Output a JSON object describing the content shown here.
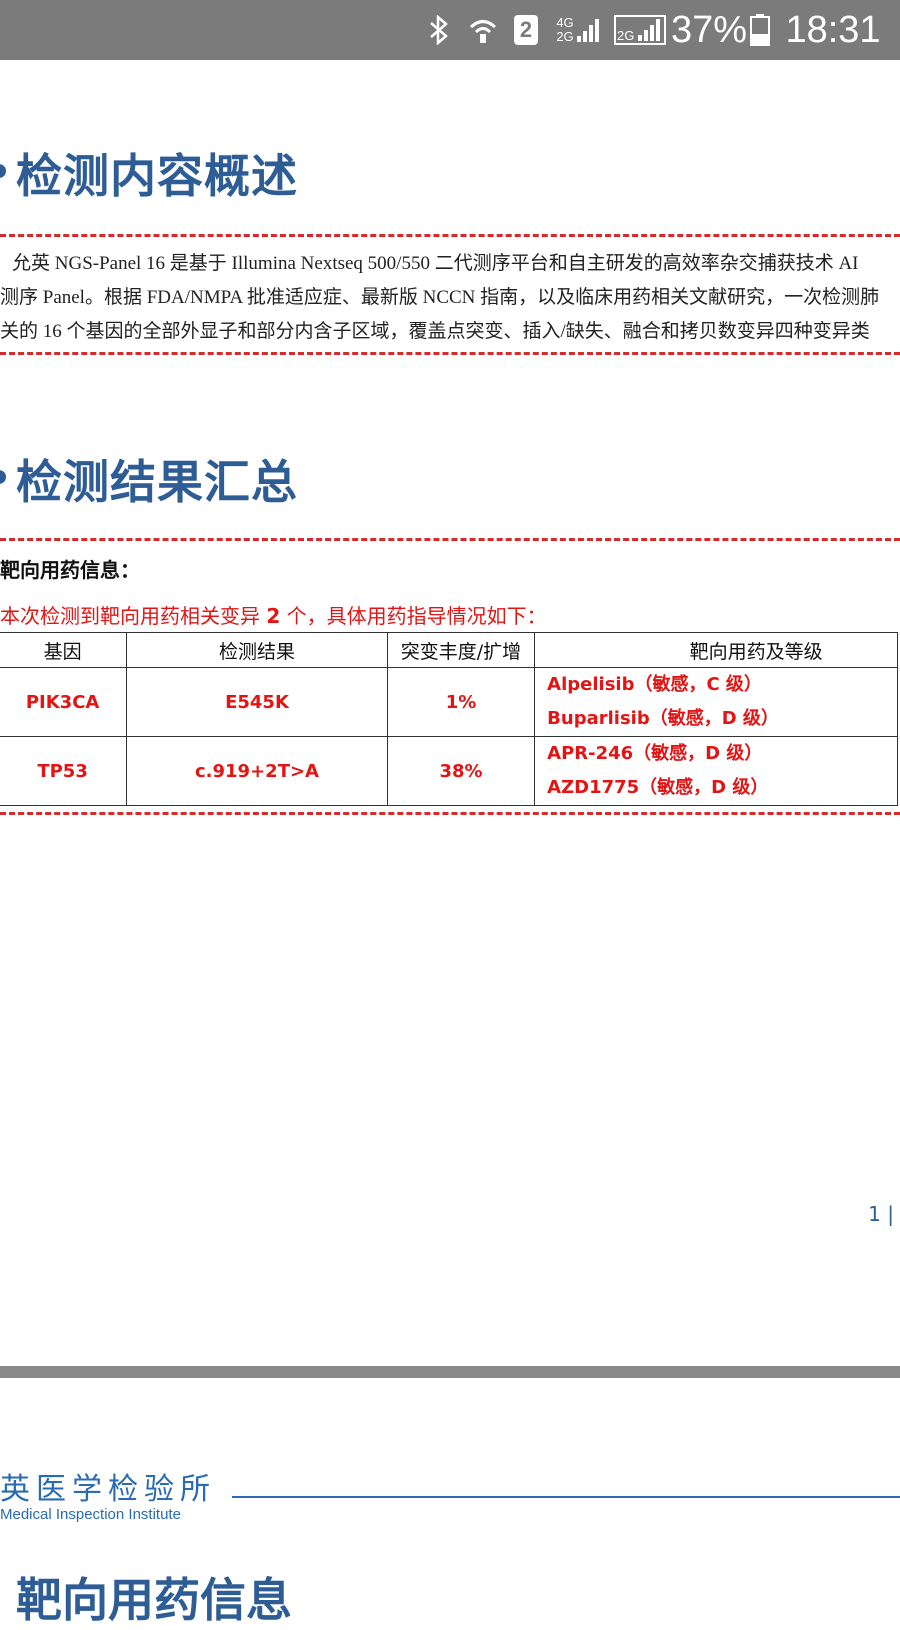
{
  "status_bar": {
    "icons": [
      "bluetooth-icon",
      "wifi-icon",
      "sim2-icon",
      "signal-4g-icon",
      "signal-2g-icon"
    ],
    "sim_badge": "2",
    "net_label_top": "4G",
    "net_label_bottom": "2G",
    "net_label_2": "2G",
    "battery_percent": "37%",
    "battery_level": 0.37,
    "time": "18:31"
  },
  "section1": {
    "title": "检测内容概述",
    "paragraph_lines": [
      "允英 NGS-Panel 16 是基于 Illumina Nextseq 500/550 二代测序平台和自主研发的高效率杂交捕获技术 AI",
      "测序 Panel。根据 FDA/NMPA 批准适应症、最新版 NCCN 指南，以及临床用药相关文献研究，一次检测肺",
      "关的 16 个基因的全部外显子和部分内含子区域，覆盖点突变、插入/缺失、融合和拷贝数变异四种变异类"
    ]
  },
  "section2": {
    "title": "检测结果汇总",
    "subtitle": "靶向用药信息：",
    "summary_prefix": "本次检测到靶向用药相关变异 ",
    "summary_count": "2",
    "summary_suffix": " 个，具体用药指导情况如下：",
    "table": {
      "headers": [
        "基因",
        "检测结果",
        "突变丰度/扩增",
        "靶向用药及等级"
      ],
      "rows": [
        {
          "gene": "PIK3CA",
          "result": "E545K",
          "abundance": "1%",
          "drugs": [
            "Alpelisib（敏感，C 级）",
            "Buparlisib（敏感，D 级）"
          ]
        },
        {
          "gene": "TP53",
          "result": "c.919+2T>A",
          "abundance": "38%",
          "drugs": [
            "APR-246（敏感，D 级）",
            "AZD1775（敏感，D 级）"
          ]
        }
      ]
    }
  },
  "page_number": "1 |",
  "footer": {
    "logo_cn": "英医学检验所",
    "logo_en": "Medical Inspection Institute"
  },
  "next_section_title": "靶向用药信息"
}
